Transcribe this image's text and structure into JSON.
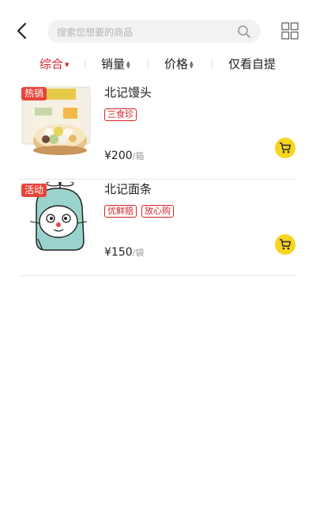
{
  "header": {
    "search_placeholder": "搜索您想要的商品"
  },
  "sort": {
    "items": [
      {
        "label": "综合",
        "active": true
      },
      {
        "label": "销量",
        "active": false
      },
      {
        "label": "价格",
        "active": false
      },
      {
        "label": "仅看自提",
        "active": false
      }
    ]
  },
  "products": [
    {
      "tag": "热销",
      "name": "北记馒头",
      "badges": [
        "三食珍"
      ],
      "price": "¥200",
      "unit": "/箱"
    },
    {
      "tag": "活动",
      "name": "北记面条",
      "badges": [
        "优鲜赔",
        "放心购"
      ],
      "price": "¥150",
      "unit": "/袋"
    }
  ],
  "colors": {
    "accent": "#d8232a",
    "cart": "#f7d51f",
    "hot_tag": "#e8443a"
  }
}
